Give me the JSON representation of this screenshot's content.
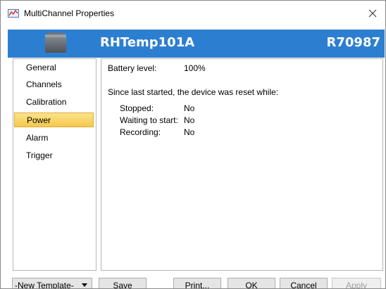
{
  "window": {
    "title": "MultiChannel Properties"
  },
  "header": {
    "device_name": "RHTemp101A",
    "serial": "R70987",
    "accent": "#2c7fd0"
  },
  "sidebar": {
    "items": [
      {
        "label": "General",
        "selected": false
      },
      {
        "label": "Channels",
        "selected": false
      },
      {
        "label": "Calibration",
        "selected": false
      },
      {
        "label": "Power",
        "selected": true
      },
      {
        "label": "Alarm",
        "selected": false
      },
      {
        "label": "Trigger",
        "selected": false
      }
    ]
  },
  "power": {
    "battery_label": "Battery level:",
    "battery_value": "100%",
    "reset_heading": "Since last started, the device was reset while:",
    "resets": [
      {
        "label": "Stopped:",
        "value": "No"
      },
      {
        "label": "Waiting to start:",
        "value": "No"
      },
      {
        "label": "Recording:",
        "value": "No"
      }
    ]
  },
  "footer": {
    "template": "-New Template-",
    "save": "Save",
    "print": "Print...",
    "ok": "OK",
    "cancel": "Cancel",
    "apply": "Apply"
  },
  "icons": {
    "app": "multichannel-app-icon",
    "close": "close-icon",
    "device": "logger-device-icon",
    "dropdown": "chevron-down-icon"
  }
}
